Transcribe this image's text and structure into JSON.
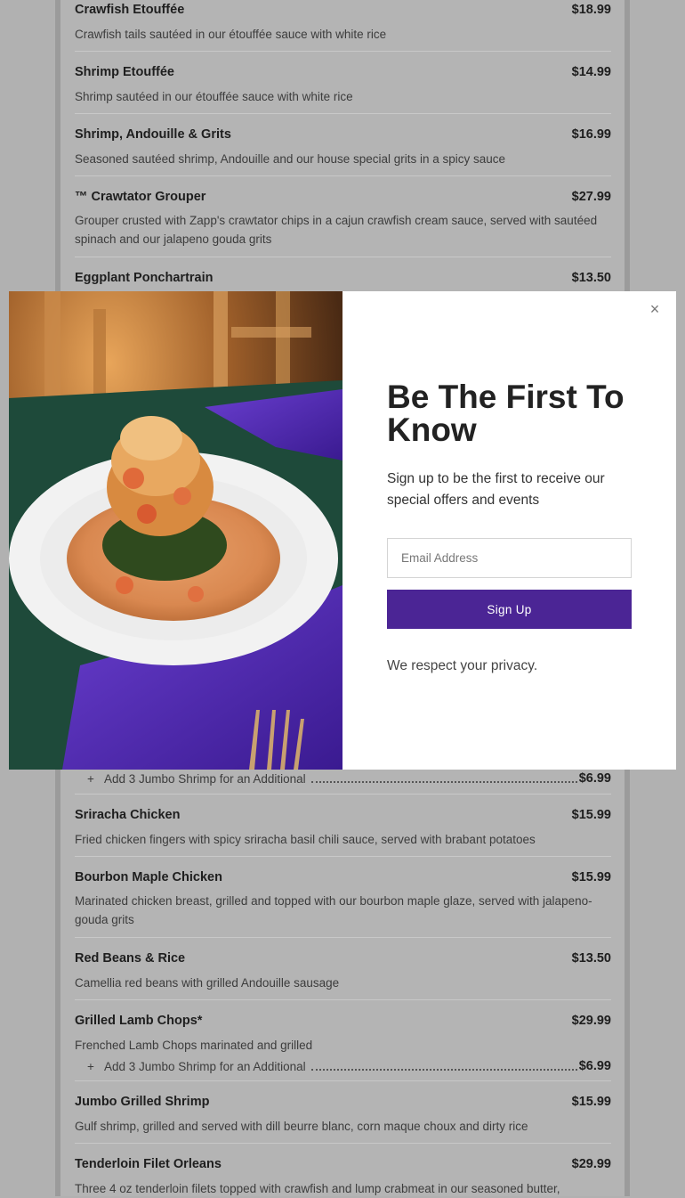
{
  "menu": {
    "items_top": [
      {
        "name": "Crawfish Etouffée",
        "price": "$18.99",
        "desc": "Crawfish tails sautéed in our étouffée sauce with white rice"
      },
      {
        "name": "Shrimp Etouffée",
        "price": "$14.99",
        "desc": "Shrimp sautéed in our étouffée sauce with white rice"
      },
      {
        "name": "Shrimp, Andouille & Grits",
        "price": "$16.99",
        "desc": "Seasoned sautéed shrimp, Andouille and our house special grits in a spicy sauce"
      },
      {
        "name": "™ Crawtator Grouper",
        "price": "$27.99",
        "desc": "Grouper crusted with Zapp's crawtator chips in a cajun crawfish cream sauce, served with sautéed spinach and our jalapeno gouda grits"
      },
      {
        "name": "Eggplant Ponchartrain",
        "price": "$13.50"
      }
    ],
    "addon_1": {
      "plus": "+",
      "label": "Add 3 Jumbo Shrimp for an Additional",
      "price": "$6.99"
    },
    "items_bottom": [
      {
        "name": "Sriracha Chicken",
        "price": "$15.99",
        "desc": "Fried chicken fingers with spicy sriracha basil chili sauce, served with brabant potatoes"
      },
      {
        "name": "Bourbon Maple Chicken",
        "price": "$15.99",
        "desc": "Marinated chicken breast, grilled and topped with our bourbon maple glaze, served with jalapeno-gouda grits"
      },
      {
        "name": "Red Beans & Rice",
        "price": "$13.50",
        "desc": "Camellia red beans with grilled Andouille sausage"
      },
      {
        "name": "Grilled Lamb Chops*",
        "price": "$29.99",
        "desc": "Frenched Lamb Chops marinated and grilled"
      },
      {
        "name": "Jumbo Grilled Shrimp",
        "price": "$15.99",
        "desc": "Gulf shrimp, grilled and served with dill beurre blanc, corn maque choux and dirty rice"
      },
      {
        "name": "Tenderloin Filet Orleans",
        "price": "$29.99",
        "desc": "Three 4 oz tenderloin filets topped with crawfish and lump crabmeat in our seasoned butter,"
      }
    ],
    "addon_2": {
      "plus": "+",
      "label": "Add 3 Jumbo Shrimp for an Additional",
      "price": "$6.99"
    }
  },
  "modal": {
    "close_label": "×",
    "title": "Be The First To Know",
    "subtitle": "Sign up to be the first to receive our special offers and events",
    "email_placeholder": "Email Address",
    "signup_label": "Sign Up",
    "privacy_text": "We respect your privacy.",
    "accent_color": "#4b2595"
  }
}
